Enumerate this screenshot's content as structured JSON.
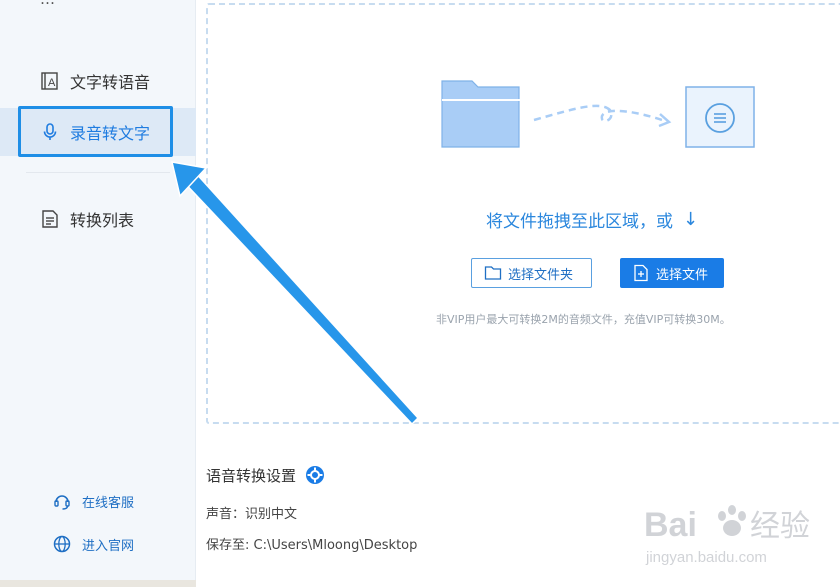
{
  "sidebar": {
    "top_partial_label": "…",
    "items": [
      {
        "label": "文字转语音",
        "icon": "text-to-speech-icon",
        "active": false
      },
      {
        "label": "录音转文字",
        "icon": "microphone-icon",
        "active": true
      },
      {
        "label": "转换列表",
        "icon": "document-list-icon",
        "active": false
      }
    ],
    "footer": [
      {
        "label": "在线客服",
        "icon": "headset-icon"
      },
      {
        "label": "进入官网",
        "icon": "globe-icon"
      }
    ]
  },
  "dropzone": {
    "prompt": "将文件拖拽至此区域，或",
    "prompt_arrow": "↓",
    "select_folder_label": "选择文件夹",
    "select_file_label": "选择文件",
    "vip_note": "非VIP用户最大可转换2M的音频文件，充值VIP可转换30M。"
  },
  "settings": {
    "title": "语音转换设置",
    "voice_label": "声音：",
    "voice_value": "识别中文",
    "save_label": "保存至:",
    "save_value": "C:\\Users\\Mloong\\Desktop"
  },
  "watermark": {
    "brand": "Bai du 经验",
    "url": "jingyan.baidu.com"
  },
  "colors": {
    "accent": "#1a7ce6",
    "highlight": "#1e8ee6",
    "sidebar_bg": "#f3f7fb",
    "dash": "#c7dcf0"
  }
}
